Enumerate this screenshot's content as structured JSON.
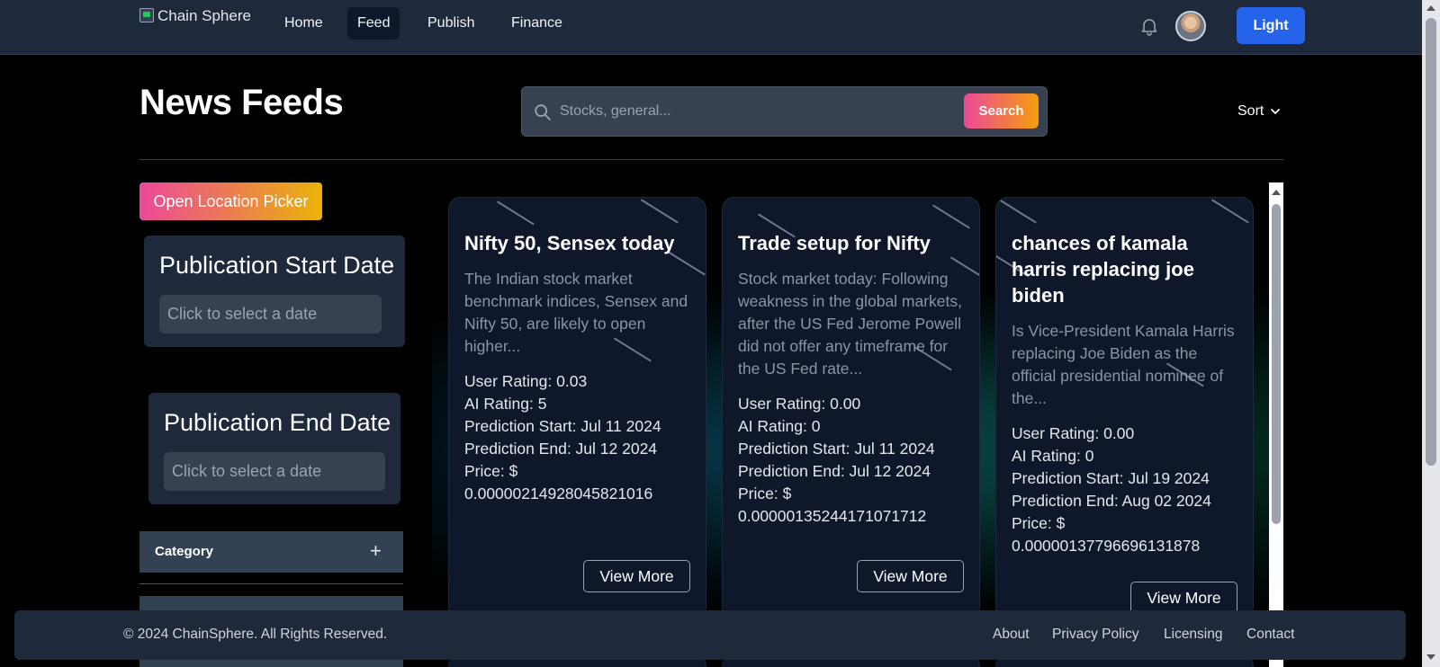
{
  "nav": {
    "logo_alt": "Chain Sphere",
    "links": [
      {
        "label": "Home",
        "active": false
      },
      {
        "label": "Feed",
        "active": true
      },
      {
        "label": "Publish",
        "active": false
      },
      {
        "label": "Finance",
        "active": false
      }
    ],
    "theme_button": "Light",
    "icons": {
      "bell": "bell-icon",
      "avatar": "user-avatar"
    }
  },
  "header": {
    "title": "News Feeds",
    "search_placeholder": "Stocks, general...",
    "search_button": "Search",
    "sort_label": "Sort"
  },
  "sidebar": {
    "location_button": "Open Location Picker",
    "start_date": {
      "title": "Publication Start Date",
      "placeholder": "Click to select a date"
    },
    "end_date": {
      "title": "Publication End Date",
      "placeholder": "Click to select a date"
    },
    "category_label": "Category",
    "category_toggle": "+"
  },
  "cards": [
    {
      "title": "Nifty 50, Sensex today",
      "excerpt": "The Indian stock market benchmark indices, Sensex and Nifty 50, are likely to open higher...",
      "user_rating": "User Rating: 0.03",
      "ai_rating": "AI Rating: 5",
      "prediction_start": "Prediction Start: Jul 11 2024",
      "prediction_end": "Prediction End: Jul 12 2024",
      "price_label": "Price: $",
      "price_value": "0.00000214928045821016",
      "button": "View More"
    },
    {
      "title": "Trade setup for Nifty",
      "excerpt": "Stock market today: Following weakness in the global markets, after the US Fed Jerome Powell did not offer any timeframe for the US Fed rate...",
      "user_rating": "User Rating: 0.00",
      "ai_rating": "AI Rating: 0",
      "prediction_start": "Prediction Start: Jul 11 2024",
      "prediction_end": "Prediction End: Jul 12 2024",
      "price_label": "Price: $",
      "price_value": "0.00000135244171071712",
      "button": "View More"
    },
    {
      "title": "chances of kamala harris replacing joe biden",
      "excerpt": "Is Vice-President Kamala Harris replacing Joe Biden as the official presidential nominee of the...",
      "user_rating": "User Rating: 0.00",
      "ai_rating": "AI Rating: 0",
      "prediction_start": "Prediction Start: Jul 19 2024",
      "prediction_end": "Prediction End: Aug 02 2024",
      "price_label": "Price: $",
      "price_value": "0.00000137796696131878",
      "button": "View More"
    }
  ],
  "footer": {
    "copyright": "© 2024 ChainSphere. All Rights Reserved.",
    "links": [
      "About",
      "Privacy Policy",
      "Licensing",
      "Contact"
    ]
  }
}
